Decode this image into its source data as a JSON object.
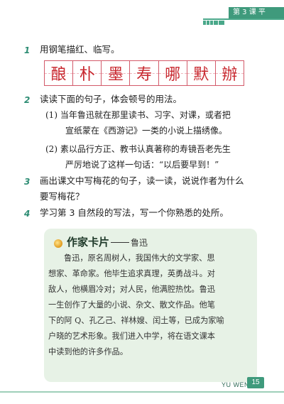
{
  "header": {
    "lesson_label": "第 3 课   平"
  },
  "exercises": [
    {
      "number": "1",
      "text": "用钢笔描红、临写。"
    },
    {
      "number": "2",
      "text": "读读下面的句子，体会顿号的用法。",
      "sub": [
        {
          "line1": "(1) 当年鲁迅就在那里读书、习字、对课，或者把",
          "line2": "宣纸蒙在《西游记》一类的小说上描绣像。"
        },
        {
          "line1": "(2) 素以品行方正、教书认真著称的寿镜吾老先生",
          "line2": "严厉地说了这样一句话：“以后要早到！”"
        }
      ]
    },
    {
      "number": "3",
      "line1": "画出课文中写梅花的句子，读一读，说说作者为什么",
      "line2": "要写梅花？"
    },
    {
      "number": "4",
      "text": "学习第 3 自然段的写法，写一个你熟悉的处所。"
    }
  ],
  "practice_chars": [
    "酿",
    "朴",
    "墨",
    "寿",
    "哪",
    "默",
    "辦"
  ],
  "author_card": {
    "title": "作家卡片",
    "subtitle": "鲁迅",
    "lines": [
      "鲁迅，原名周树人，我国伟大的文学家、思",
      "想家、革命家。他毕生追求真理，英勇战斗。对",
      "敌人，他横眉冷对；对人民，他满腔热忱。鲁迅",
      "一生创作了大量的小说、杂文、散文作品。他笔",
      "下的阿 Q、孔乙己、祥林嫂、闰土等，已成为家喻",
      "户晓的艺术形象。我们进入中学，将在语文课本",
      "中读到他的许多作品。"
    ]
  },
  "footer": {
    "label": "YU WEN",
    "page_number": "15"
  },
  "colors": {
    "accent": "#3f9a7c",
    "practice_red": "#c8282f",
    "card_bg": "#e7f2e6"
  }
}
